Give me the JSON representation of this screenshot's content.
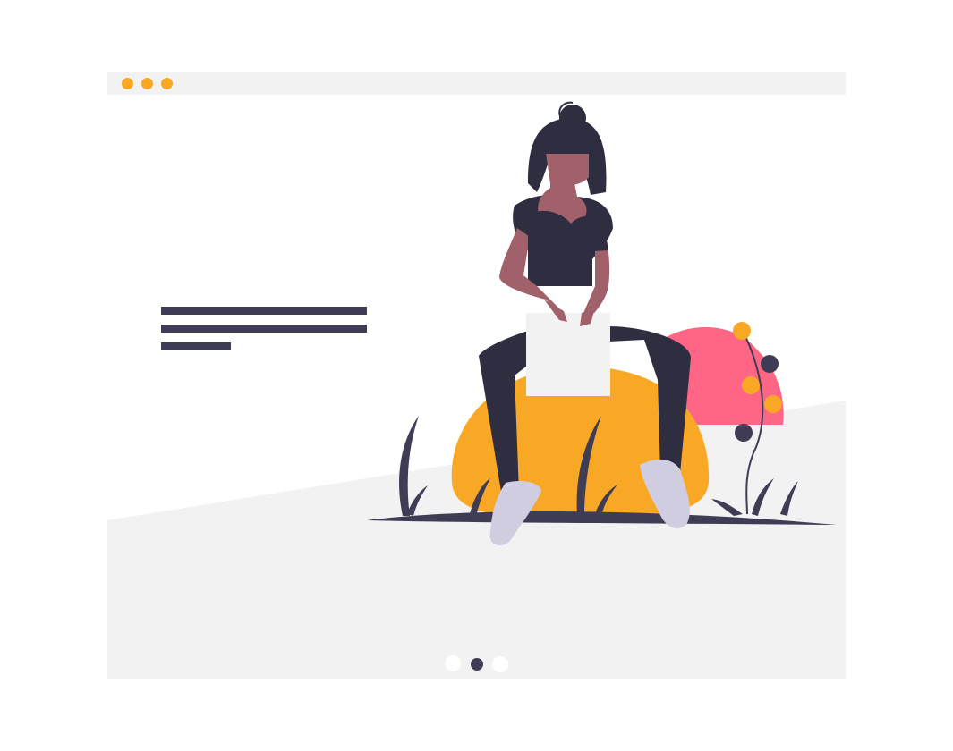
{
  "colors": {
    "accent": "#f9a826",
    "dark": "#2f2e41",
    "text_line": "#3f3d56",
    "background_slope": "#f2f2f2",
    "pink": "#ff6584",
    "skin": "#a0616a",
    "shoe": "#d0cde1"
  },
  "window": {
    "controls": [
      "window-dot",
      "window-dot",
      "window-dot"
    ]
  },
  "carousel": {
    "slide_count": 3,
    "active_index": 1
  }
}
